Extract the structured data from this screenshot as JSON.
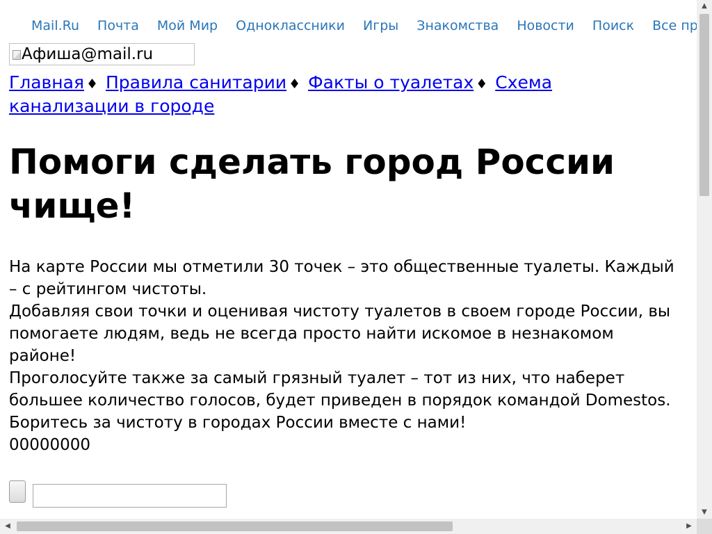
{
  "portal_nav": [
    "Mail.Ru",
    "Почта",
    "Мой Мир",
    "Одноклассники",
    "Игры",
    "Знакомства",
    "Новости",
    "Поиск",
    "Все проекты"
  ],
  "logo": {
    "alt": "Афиша@mail.ru"
  },
  "section_nav": {
    "items": [
      "Главная",
      "Правила санитарии",
      "Факты о туалетах",
      "Схема канализации в городе"
    ],
    "separator": "♦"
  },
  "page_title": "Помоги сделать город России чище!",
  "body": {
    "p1": "На карте России мы отметили 30 точек – это общественные туалеты. Каждый – с рейтингом чистоты.",
    "p2": "Добавляя свои точки и оценивая чистоту туалетов в своем городе России, вы помогаете людям, ведь не всегда просто найти искомое в незнакомом районе!",
    "p3": "Проголосуйте также за самый грязный туалет – тот из них, что наберет большее количество голосов, будет приведен в порядок командой Domestos.",
    "p4": "Боритесь за чистоту в городах России вместе с нами!",
    "counter": "00000000"
  },
  "input": {
    "value": "",
    "placeholder": ""
  },
  "scrollbars": {
    "up_icon": "▲",
    "down_icon": "▼",
    "left_icon": "◀",
    "right_icon": "▶"
  }
}
